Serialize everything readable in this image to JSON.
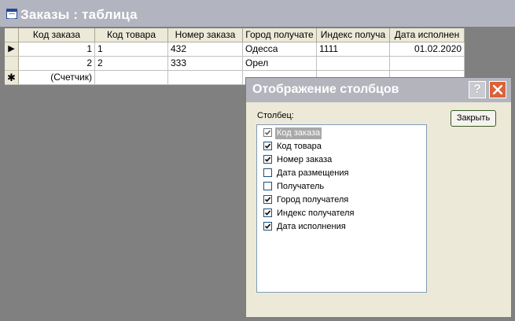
{
  "window": {
    "title": "Заказы : таблица"
  },
  "table": {
    "columns": [
      "Код заказа",
      "Код товара",
      "Номер заказа",
      "Город получате",
      "Индекс получа",
      "Дата исполнен"
    ],
    "rows": [
      {
        "selector": "▶",
        "order_id": "1",
        "product_id": "1",
        "order_number": "432",
        "city": "Одесса",
        "index": "1111",
        "date": "01.02.2020"
      },
      {
        "selector": "",
        "order_id": "2",
        "product_id": "2",
        "order_number": "333",
        "city": "Орел",
        "index": "",
        "date": ""
      }
    ],
    "new_row": {
      "selector": "✱",
      "placeholder": "(Счетчик)"
    }
  },
  "dialog": {
    "title": "Отображение столбцов",
    "help_label": "?",
    "list_label": "Столбец:",
    "close_button": "Закрыть",
    "items": [
      {
        "label": "Код заказа",
        "checked": true,
        "selected": true
      },
      {
        "label": "Код товара",
        "checked": true,
        "selected": false
      },
      {
        "label": "Номер заказа",
        "checked": true,
        "selected": false
      },
      {
        "label": "Дата размещения",
        "checked": false,
        "selected": false
      },
      {
        "label": "Получатель",
        "checked": false,
        "selected": false
      },
      {
        "label": "Город получателя",
        "checked": true,
        "selected": false
      },
      {
        "label": "Индекс получателя",
        "checked": true,
        "selected": false
      },
      {
        "label": "Дата исполнения",
        "checked": true,
        "selected": false
      }
    ]
  },
  "colors": {
    "titlebar": "#b2b4bf",
    "workspace": "#808080",
    "dialog_bg": "#ece9d8",
    "close_button": "#d9643b"
  },
  "icons": {
    "window": "table-icon",
    "help": "help-icon",
    "close": "close-icon",
    "row_current": "row-pointer-icon",
    "row_new": "new-record-icon",
    "check": "check-icon"
  }
}
